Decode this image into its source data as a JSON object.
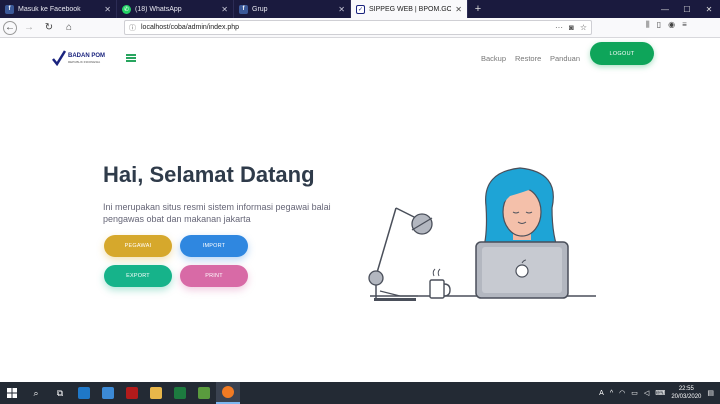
{
  "browser": {
    "tabs": [
      {
        "title": "Masuk ke Facebook",
        "icon": "facebook-icon",
        "color": "#3b5998",
        "glyph": "f"
      },
      {
        "title": "(18) WhatsApp",
        "icon": "whatsapp-icon",
        "color": "#25d366",
        "glyph": "✆"
      },
      {
        "title": "Grup",
        "icon": "facebook-icon",
        "color": "#3b5998",
        "glyph": "f"
      },
      {
        "title": "SIPPEG WEB | BPOM.GO.ID",
        "icon": "bpom-logo-icon",
        "color": "#1a237e",
        "glyph": "✓"
      }
    ],
    "active_tab": 3,
    "url": "localhost/coba/admin/index.php",
    "url_more": "···"
  },
  "site": {
    "logo_text": "BADAN POM",
    "logo_sub": "REPUBLIK INDONESIA",
    "menu": [
      "Backup",
      "Restore",
      "Panduan"
    ],
    "logout_label": "LOGOUT"
  },
  "hero": {
    "title": "Hai, Selamat Datang",
    "desc": "Ini merupakan situs resmi sistem informasi pegawai balai pengawas obat dan makanan jakarta",
    "buttons": [
      {
        "label": "PEGAWAI",
        "color": "#d6a82c"
      },
      {
        "label": "IMPORT",
        "color": "#2f87e0"
      },
      {
        "label": "EXPORT",
        "color": "#16b38a"
      },
      {
        "label": "PRINT",
        "color": "#d86aa6"
      }
    ]
  },
  "taskbar": {
    "time": "22:55",
    "date": "20/03/2020",
    "lang": "A"
  },
  "colors": {
    "accent": "#0ea55a",
    "title": "#2f3b4a"
  }
}
